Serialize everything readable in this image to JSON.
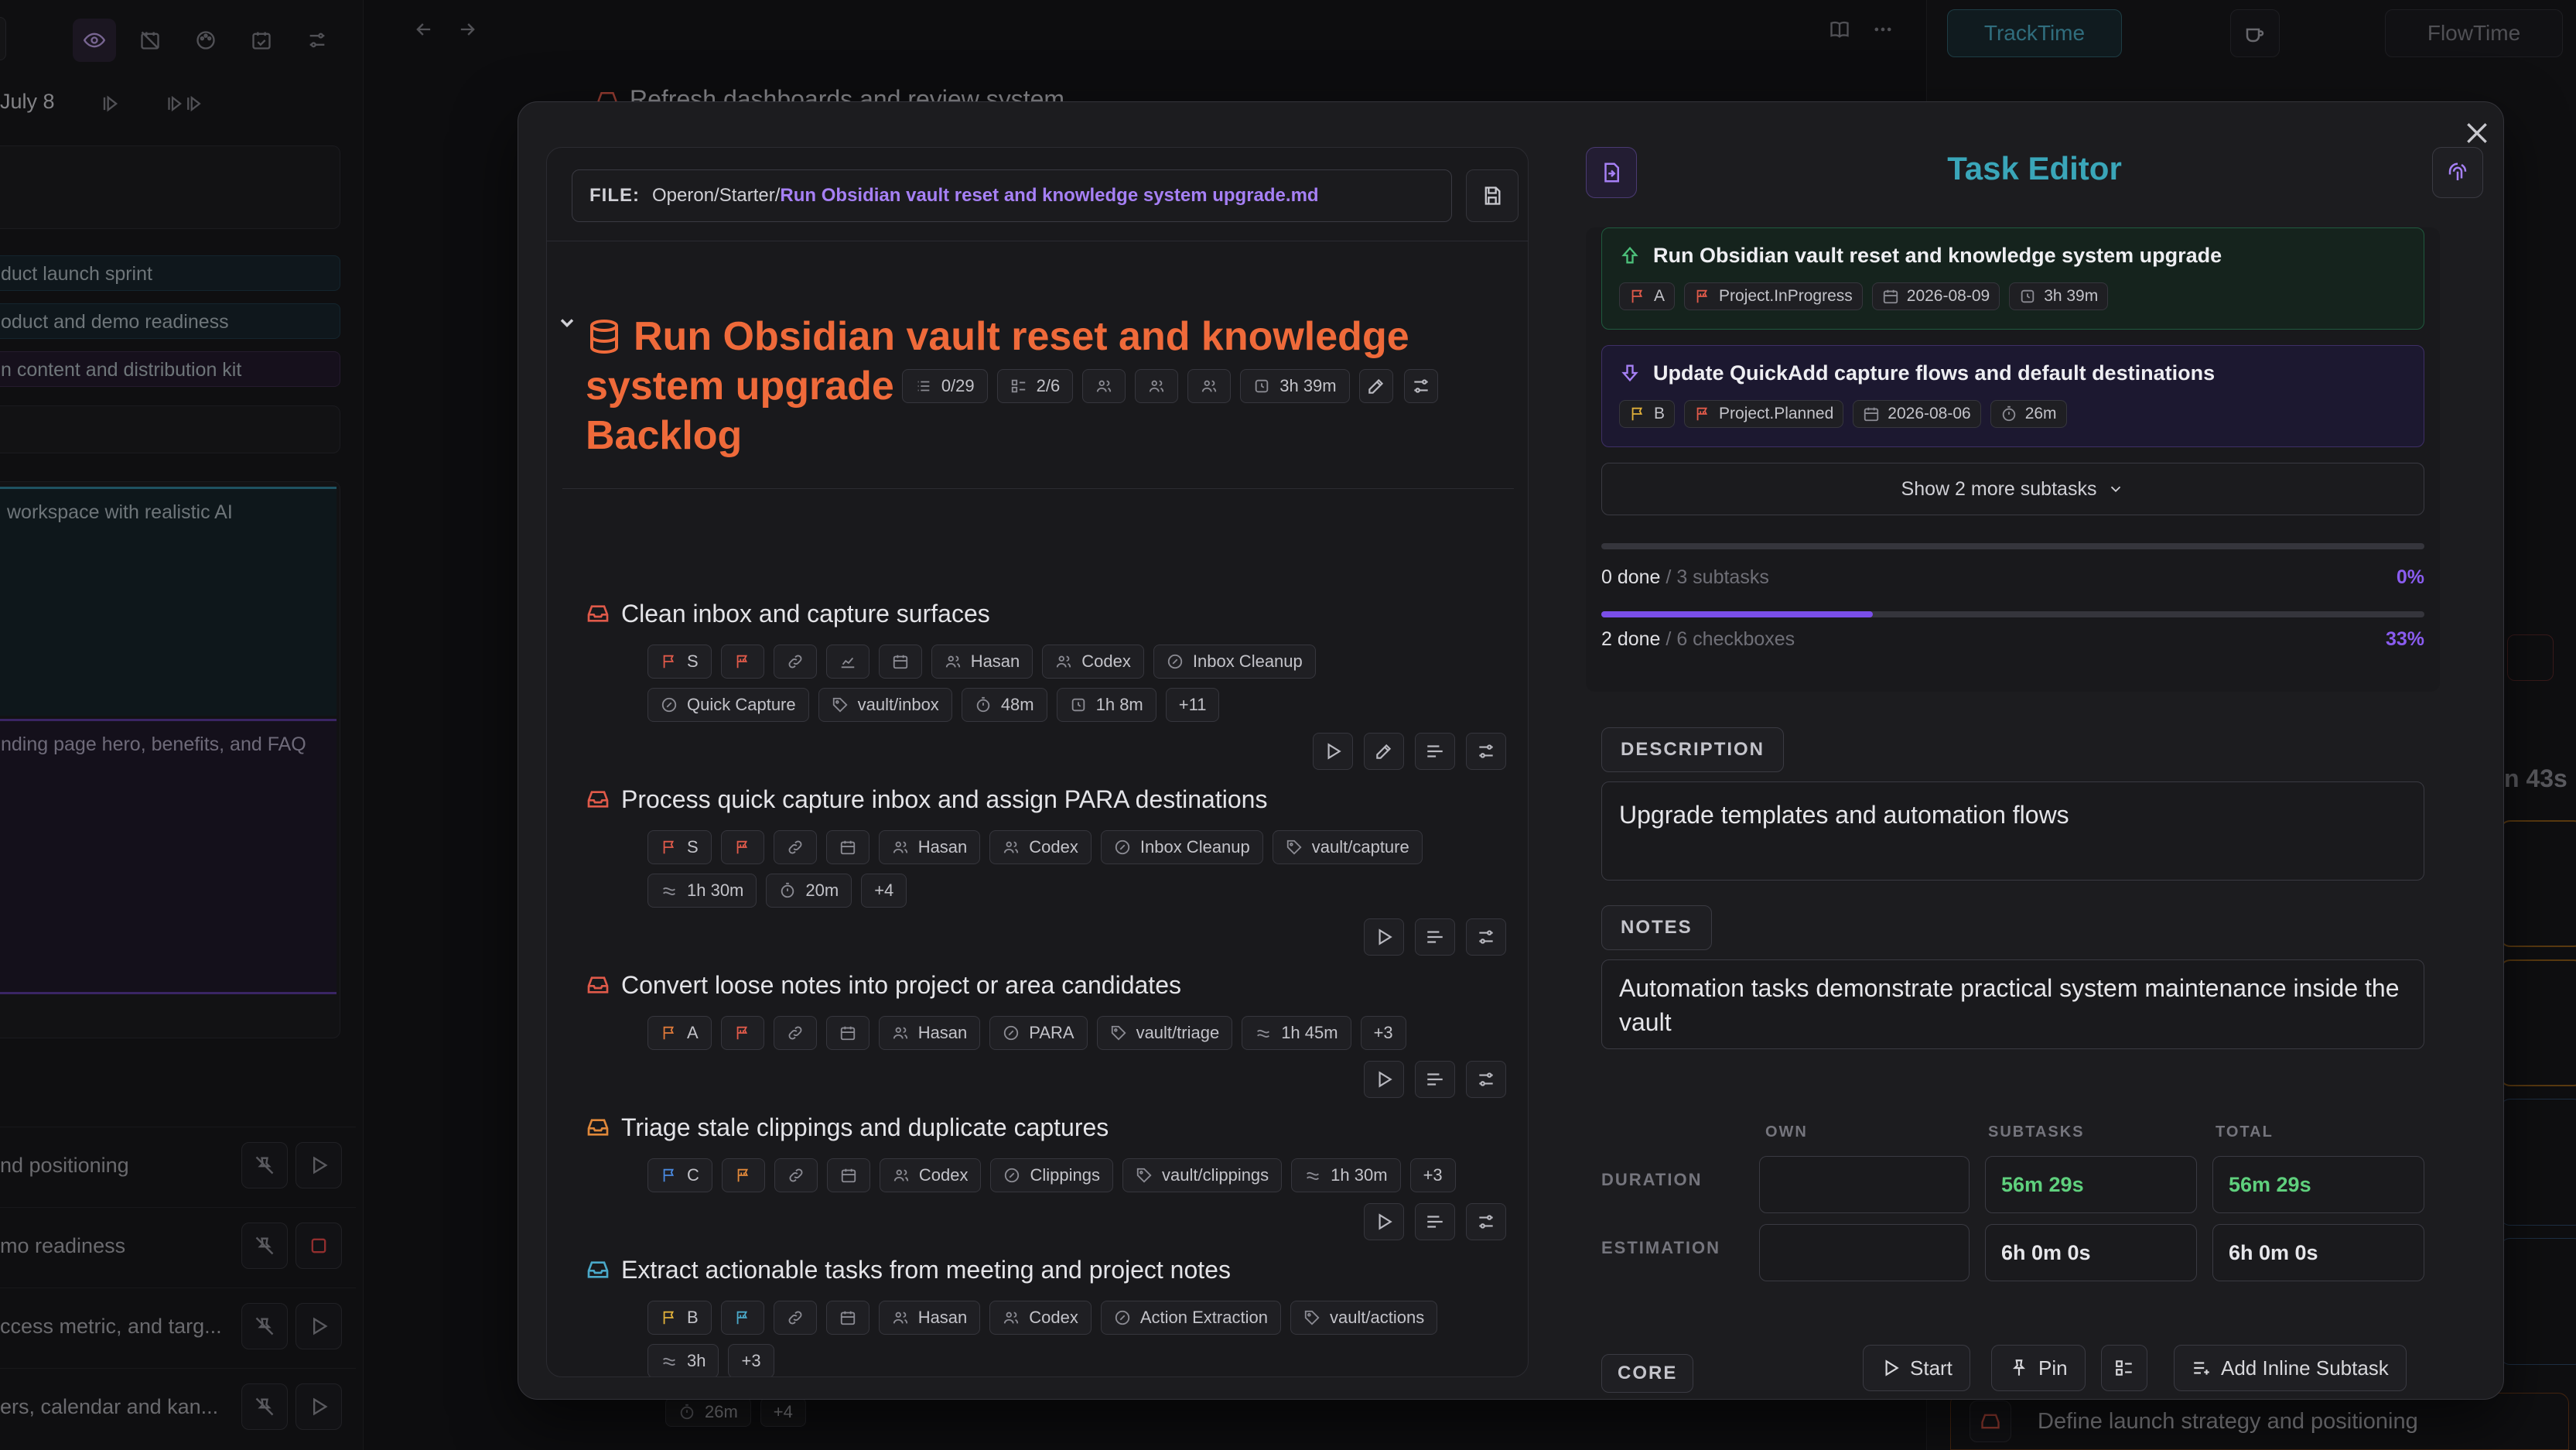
{
  "background": {
    "left": {
      "date_label": "July 8",
      "list_items": [
        "duct launch sprint",
        "oduct and demo readiness",
        "n content and distribution kit"
      ],
      "card_texts": [
        "workspace with realistic AI",
        "nding page hero, benefits, and FAQ"
      ],
      "bottom_rows": [
        "nd positioning",
        "mo readiness",
        "ccess metric, and targ...",
        "ers, calendar and kan..."
      ]
    },
    "mid": {
      "top_task": "Refresh dashboards and review system",
      "bottom_chips": [
        "26m",
        "+4"
      ]
    },
    "right": {
      "tabs": [
        "TrackTime",
        "FlowTime"
      ],
      "timer_partial": "n 43s",
      "bottom_item": "Define launch strategy and positioning"
    }
  },
  "modal": {
    "file": {
      "prefix": "FILE:",
      "path": "Operon/Starter/",
      "name": "Run Obsidian vault reset and knowledge system upgrade.md"
    },
    "title": {
      "line1": "Run Obsidian vault reset and knowledge",
      "line2": "system upgrade",
      "status": "Backlog",
      "chips": {
        "subtasks": "0/29",
        "checklist": "2/6",
        "time": "3h 39m"
      }
    },
    "tasks": [
      {
        "title": "Clean inbox and capture surfaces",
        "color": "#e05a4a",
        "rows": [
          [
            {
              "icon": "flag-icon",
              "label": "S",
              "color": "#e05a4a"
            },
            {
              "icon": "priority-icon",
              "label": ""
            },
            {
              "icon": "link-icon",
              "label": ""
            },
            {
              "icon": "chart-icon",
              "label": ""
            },
            {
              "icon": "calendar-icon",
              "label": ""
            },
            {
              "icon": "user-icon",
              "label": "Hasan"
            },
            {
              "icon": "user-icon",
              "label": "Codex"
            },
            {
              "icon": "area-icon",
              "label": "Inbox Cleanup"
            }
          ],
          [
            {
              "icon": "area-icon",
              "label": "Quick Capture"
            },
            {
              "icon": "tag-icon",
              "label": "vault/inbox"
            },
            {
              "icon": "timer-icon",
              "label": "48m"
            },
            {
              "icon": "clock-icon",
              "label": "1h 8m"
            },
            {
              "icon": "",
              "label": "+11"
            }
          ]
        ],
        "actions": [
          "play",
          "edit",
          "list",
          "sliders"
        ]
      },
      {
        "title": "Process quick capture inbox and assign PARA destinations",
        "color": "#e05a4a",
        "rows": [
          [
            {
              "icon": "flag-icon",
              "label": "S",
              "color": "#e05a4a"
            },
            {
              "icon": "priority-icon",
              "label": ""
            },
            {
              "icon": "link-icon",
              "label": ""
            },
            {
              "icon": "calendar-icon",
              "label": ""
            },
            {
              "icon": "user-icon",
              "label": "Hasan"
            },
            {
              "icon": "user-icon",
              "label": "Codex"
            },
            {
              "icon": "area-icon",
              "label": "Inbox Cleanup"
            },
            {
              "icon": "tag-icon",
              "label": "vault/capture"
            }
          ],
          [
            {
              "icon": "approx-icon",
              "label": "1h 30m"
            },
            {
              "icon": "timer-icon",
              "label": "20m"
            },
            {
              "icon": "",
              "label": "+4"
            }
          ]
        ],
        "actions": [
          "play",
          "list",
          "sliders"
        ]
      },
      {
        "title": "Convert loose notes into project or area candidates",
        "color": "#e05a4a",
        "rows": [
          [
            {
              "icon": "flag-icon",
              "label": "A",
              "color": "#e07a3a"
            },
            {
              "icon": "priority-icon",
              "label": ""
            },
            {
              "icon": "link-icon",
              "label": ""
            },
            {
              "icon": "calendar-icon",
              "label": ""
            },
            {
              "icon": "user-icon",
              "label": "Hasan"
            },
            {
              "icon": "area-icon",
              "label": "PARA"
            },
            {
              "icon": "tag-icon",
              "label": "vault/triage"
            },
            {
              "icon": "approx-icon",
              "label": "1h 45m"
            },
            {
              "icon": "",
              "label": "+3"
            }
          ]
        ],
        "actions": [
          "play",
          "list",
          "sliders"
        ]
      },
      {
        "title": "Triage stale clippings and duplicate captures",
        "color": "#e0883a",
        "rows": [
          [
            {
              "icon": "flag-icon",
              "label": "C",
              "color": "#4a8ae0"
            },
            {
              "icon": "priority-icon",
              "label": ""
            },
            {
              "icon": "link-icon",
              "label": ""
            },
            {
              "icon": "calendar-icon",
              "label": ""
            },
            {
              "icon": "user-icon",
              "label": "Codex"
            },
            {
              "icon": "area-icon",
              "label": "Clippings"
            },
            {
              "icon": "tag-icon",
              "label": "vault/clippings"
            },
            {
              "icon": "approx-icon",
              "label": "1h 30m"
            },
            {
              "icon": "",
              "label": "+3"
            }
          ]
        ],
        "actions": [
          "play",
          "list",
          "sliders"
        ]
      },
      {
        "title": "Extract actionable tasks from meeting and project notes",
        "color": "#4aa8c8",
        "rows": [
          [
            {
              "icon": "flag-icon",
              "label": "B",
              "color": "#e0b03a"
            },
            {
              "icon": "priority-icon",
              "label": ""
            },
            {
              "icon": "link-icon",
              "label": ""
            },
            {
              "icon": "calendar-icon",
              "label": ""
            },
            {
              "icon": "user-icon",
              "label": "Hasan"
            },
            {
              "icon": "user-icon",
              "label": "Codex"
            },
            {
              "icon": "area-icon",
              "label": "Action Extraction"
            },
            {
              "icon": "tag-icon",
              "label": "vault/actions"
            }
          ],
          [
            {
              "icon": "approx-icon",
              "label": "3h"
            },
            {
              "icon": "",
              "label": "+3"
            }
          ]
        ],
        "actions": []
      }
    ],
    "editor": {
      "title": "Task Editor",
      "parent": {
        "title": "Run Obsidian vault reset and knowledge system upgrade",
        "priority": "A",
        "status": "Project.InProgress",
        "date": "2026-08-09",
        "time": "3h 39m"
      },
      "child": {
        "title": "Update QuickAdd capture flows and default destinations",
        "priority": "B",
        "status": "Project.Planned",
        "date": "2026-08-06",
        "time": "26m"
      },
      "show_more": "Show 2 more subtasks",
      "progress_subtasks": {
        "done": "0 done",
        "rest": "/ 3 subtasks",
        "pct": "0%",
        "fraction": 0
      },
      "progress_checkboxes": {
        "done": "2 done",
        "rest": "/ 6 checkboxes",
        "pct": "33%",
        "fraction": 0.33
      },
      "description_label": "DESCRIPTION",
      "description": "Upgrade templates and automation flows",
      "notes_label": "NOTES",
      "notes": "Automation tasks demonstrate practical system maintenance inside the vault",
      "table": {
        "cols": [
          "OWN",
          "SUBTASKS",
          "TOTAL"
        ],
        "duration_label": "DURATION",
        "estimation_label": "ESTIMATION",
        "duration": [
          "",
          "56m 29s",
          "56m 29s"
        ],
        "estimation": [
          "",
          "6h 0m 0s",
          "6h 0m 0s"
        ]
      },
      "core_label": "CORE",
      "buttons": {
        "start": "Start",
        "pin": "Pin",
        "inline": "Add Inline Subtask"
      }
    },
    "colors": {
      "accent_orange": "#ef6a3a",
      "accent_teal": "#3aa6b9",
      "accent_purple": "#8a5cf0",
      "green": "#5fd07d"
    }
  }
}
